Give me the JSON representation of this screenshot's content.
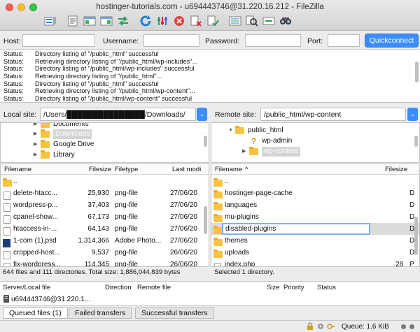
{
  "window": {
    "title": "hostinger-tutorials.com - u694443746@31.220.16.212 - FileZilla"
  },
  "toolbar": {
    "icons": [
      "site-manager-icon",
      "message-log-icon",
      "local-tree-icon",
      "remote-tree-icon",
      "refresh-icon",
      "process-queue-icon",
      "cancel-icon",
      "disconnect-icon",
      "reconnect-icon",
      "filter-icon",
      "compare-icon",
      "sync-browse-icon",
      "search-icon"
    ]
  },
  "quickconnect": {
    "host_label": "Host:",
    "host_value": "",
    "username_label": "Username:",
    "username_value": "",
    "password_label": "Password:",
    "password_value": "",
    "port_label": "Port:",
    "port_value": "",
    "button_label": "Quickconnect"
  },
  "log": [
    {
      "label": "Status:",
      "text": "Directory listing of \"/public_html\" successful"
    },
    {
      "label": "Status:",
      "text": "Retrieving directory listing of \"/public_html/wp-includes\"..."
    },
    {
      "label": "Status:",
      "text": "Directory listing of \"/public_html/wp-includes\" successful"
    },
    {
      "label": "Status:",
      "text": "Retrieving directory listing of \"/public_html\"..."
    },
    {
      "label": "Status:",
      "text": "Directory listing of \"/public_html\" successful"
    },
    {
      "label": "Status:",
      "text": "Retrieving directory listing of \"/public_html/wp-content\"..."
    },
    {
      "label": "Status:",
      "text": "Directory listing of \"/public_html/wp-content\" successful"
    }
  ],
  "local": {
    "label": "Local site:",
    "path": "/Users/███████████████/Downloads/",
    "tree": [
      {
        "label": "Documents",
        "arrow": "▶"
      },
      {
        "label": "Downloads",
        "arrow": "▶"
      },
      {
        "label": "Google Drive",
        "arrow": "▶"
      },
      {
        "label": "Library",
        "arrow": "▶"
      }
    ],
    "columns": {
      "filename": "Filename",
      "filesize": "Filesize",
      "filetype": "Filetype",
      "modified": "Last modi"
    },
    "files": [
      {
        "name": "..",
        "size": "",
        "type": "",
        "date": ""
      },
      {
        "name": "delete-htacc...",
        "size": "25,930",
        "type": "png-file",
        "date": "27/06/20"
      },
      {
        "name": "wordpress-p...",
        "size": "37,403",
        "type": "png-file",
        "date": "27/06/20"
      },
      {
        "name": "cpanel-show...",
        "size": "67,173",
        "type": "png-file",
        "date": "27/06/20"
      },
      {
        "name": "htaccess-in-...",
        "size": "64,143",
        "type": "png-file",
        "date": "27/06/20"
      },
      {
        "name": "1-com (1).psd",
        "size": "1,314,366",
        "type": "Adobe Photo...",
        "date": "27/06/20"
      },
      {
        "name": "cropped-host...",
        "size": "9,537",
        "type": "png-file",
        "date": "26/06/20"
      },
      {
        "name": "fix-wordpress...",
        "size": "114,345",
        "type": "png-file",
        "date": "26/06/20"
      }
    ],
    "status": "644 files and 111 directories. Total size: 1,886,044,839 bytes"
  },
  "remote": {
    "label": "Remote site:",
    "path": "/public_html/wp-content",
    "tree": [
      {
        "label": "public_html",
        "arrow": "▼"
      },
      {
        "label": "wp-admin",
        "arrow": ""
      },
      {
        "label": "wp-content",
        "arrow": "▶"
      }
    ],
    "columns": {
      "filename": "Filename",
      "sort_arrow": "^",
      "filesize": "Filesize"
    },
    "files": [
      {
        "name": "..",
        "size": "",
        "flag": ""
      },
      {
        "name": "hostinger-page-cache",
        "size": "",
        "flag": "D"
      },
      {
        "name": "languages",
        "size": "",
        "flag": "D"
      },
      {
        "name": "mu-plugins",
        "size": "",
        "flag": "D"
      },
      {
        "name": "disabled-plugins",
        "size": "",
        "flag": "D"
      },
      {
        "name": "themes",
        "size": "",
        "flag": "D"
      },
      {
        "name": "uploads",
        "size": "",
        "flag": "D"
      },
      {
        "name": "index.php",
        "size": "28",
        "flag": "P"
      }
    ],
    "status": "Selected 1 directory."
  },
  "queue": {
    "columns": {
      "server": "Server/Local file",
      "direction": "Direction",
      "remote": "Remote file",
      "size": "Size",
      "priority": "Priority",
      "status": "Status"
    },
    "row": {
      "server": "u694443746@31.220.1..."
    }
  },
  "tabs": [
    {
      "label": "Queued files (1)"
    },
    {
      "label": "Failed transfers"
    },
    {
      "label": "Successful transfers"
    }
  ],
  "bottom": {
    "queue": "Queue: 1.6 KiB"
  },
  "colors": {
    "accent": "#3c8dfc",
    "folder": "#f6c343"
  }
}
